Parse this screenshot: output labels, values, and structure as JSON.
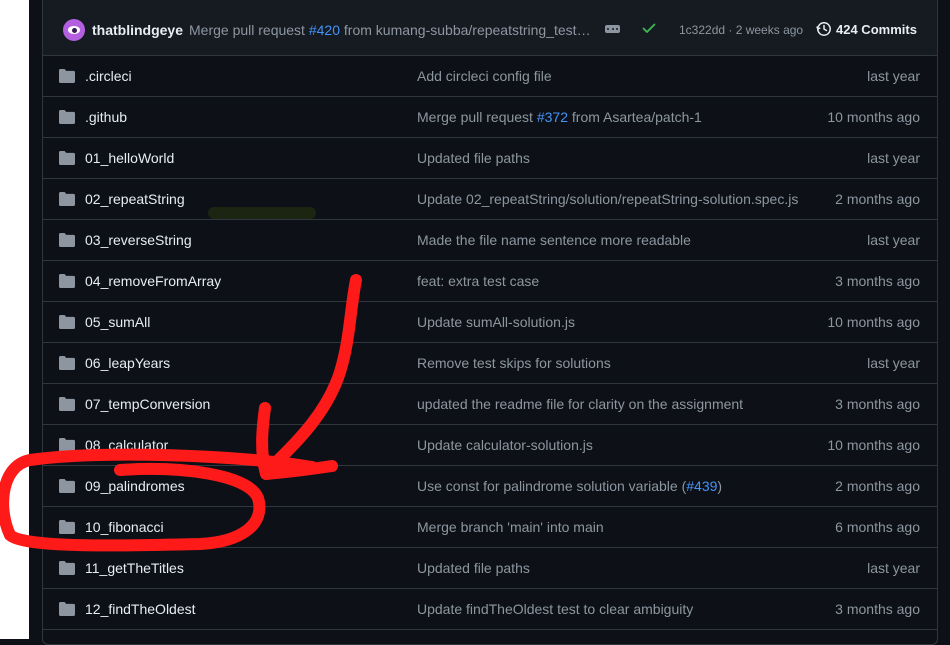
{
  "latest_commit": {
    "author": "thatblindgeye",
    "message_prefix": "Merge pull request ",
    "pr_ref": "#420",
    "message_suffix": " from kumang-subba/repeatstring_test…",
    "sha_age": "1c322dd · 2 weeks ago",
    "commits_count": "424 Commits",
    "avatar_icon": "eye-avatar",
    "status_icon": "check-icon",
    "status_color": "#3fb950"
  },
  "files": [
    {
      "name": ".circleci",
      "commit": "Add circleci config file",
      "date": "last year"
    },
    {
      "name": ".github",
      "commit_prefix": "Merge pull request ",
      "pr": "#372",
      "commit_suffix": " from Asartea/patch-1",
      "date": "10 months ago"
    },
    {
      "name": "01_helloWorld",
      "commit": "Updated file paths",
      "date": "last year"
    },
    {
      "name": "02_repeatString",
      "commit": "Update 02_repeatString/solution/repeatString-solution.spec.js",
      "date": "2 months ago"
    },
    {
      "name": "03_reverseString",
      "commit": "Made the file name sentence more readable",
      "date": "last year"
    },
    {
      "name": "04_removeFromArray",
      "commit": "feat: extra test case",
      "date": "3 months ago"
    },
    {
      "name": "05_sumAll",
      "commit": "Update sumAll-solution.js",
      "date": "10 months ago"
    },
    {
      "name": "06_leapYears",
      "commit": "Remove test skips for solutions",
      "date": "last year"
    },
    {
      "name": "07_tempConversion",
      "commit": "updated the readme file for clarity on the assignment",
      "date": "3 months ago"
    },
    {
      "name": "08_calculator",
      "commit": "Update calculator-solution.js",
      "date": "10 months ago"
    },
    {
      "name": "09_palindromes",
      "commit_prefix": "Use const for palindrome solution variable (",
      "pr": "#439",
      "commit_suffix": ")",
      "date": "2 months ago"
    },
    {
      "name": "10_fibonacci",
      "commit": "Merge branch 'main' into main",
      "date": "6 months ago"
    },
    {
      "name": "11_getTheTitles",
      "commit": "Updated file paths",
      "date": "last year"
    },
    {
      "name": "12_findTheOldest",
      "commit": "Update findTheOldest test to clear ambiguity",
      "date": "3 months ago"
    }
  ],
  "colors": {
    "background": "#0d1117",
    "header_bg": "#161b22",
    "border": "#30363d",
    "muted_text": "#8d96a0",
    "link": "#4493f8",
    "folder": "#8d96a0",
    "annotation_red": "#ff1a1a"
  },
  "annotation": {
    "arrow": "red-arrow-pointing-down",
    "highlight": "red-loop-around-09_palindromes-and-10_fibonacci"
  }
}
